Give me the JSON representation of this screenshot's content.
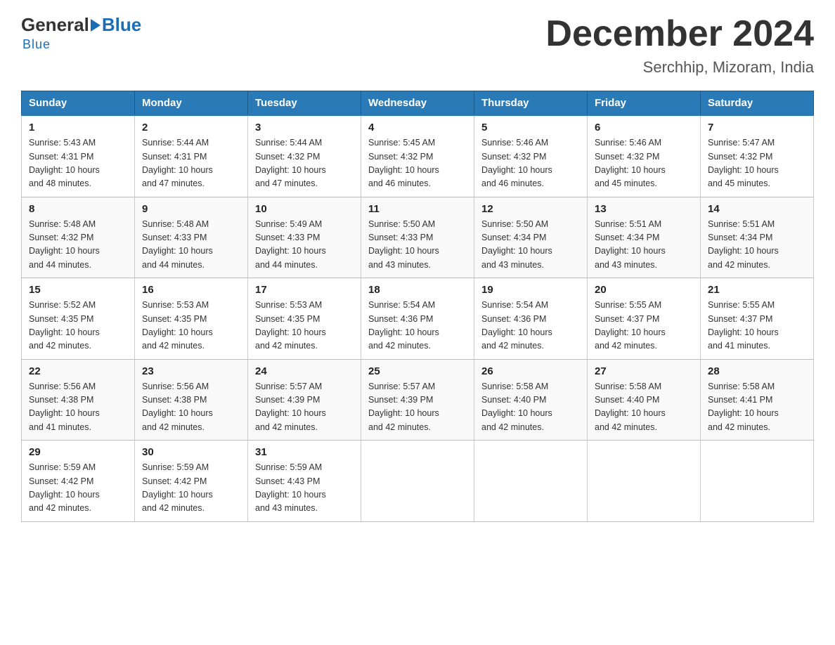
{
  "logo": {
    "general": "General",
    "blue": "Blue",
    "underline": "Blue"
  },
  "header": {
    "title": "December 2024",
    "subtitle": "Serchhip, Mizoram, India"
  },
  "weekdays": [
    "Sunday",
    "Monday",
    "Tuesday",
    "Wednesday",
    "Thursday",
    "Friday",
    "Saturday"
  ],
  "weeks": [
    [
      {
        "day": "1",
        "sunrise": "5:43 AM",
        "sunset": "4:31 PM",
        "daylight": "10 hours and 48 minutes."
      },
      {
        "day": "2",
        "sunrise": "5:44 AM",
        "sunset": "4:31 PM",
        "daylight": "10 hours and 47 minutes."
      },
      {
        "day": "3",
        "sunrise": "5:44 AM",
        "sunset": "4:32 PM",
        "daylight": "10 hours and 47 minutes."
      },
      {
        "day": "4",
        "sunrise": "5:45 AM",
        "sunset": "4:32 PM",
        "daylight": "10 hours and 46 minutes."
      },
      {
        "day": "5",
        "sunrise": "5:46 AM",
        "sunset": "4:32 PM",
        "daylight": "10 hours and 46 minutes."
      },
      {
        "day": "6",
        "sunrise": "5:46 AM",
        "sunset": "4:32 PM",
        "daylight": "10 hours and 45 minutes."
      },
      {
        "day": "7",
        "sunrise": "5:47 AM",
        "sunset": "4:32 PM",
        "daylight": "10 hours and 45 minutes."
      }
    ],
    [
      {
        "day": "8",
        "sunrise": "5:48 AM",
        "sunset": "4:32 PM",
        "daylight": "10 hours and 44 minutes."
      },
      {
        "day": "9",
        "sunrise": "5:48 AM",
        "sunset": "4:33 PM",
        "daylight": "10 hours and 44 minutes."
      },
      {
        "day": "10",
        "sunrise": "5:49 AM",
        "sunset": "4:33 PM",
        "daylight": "10 hours and 44 minutes."
      },
      {
        "day": "11",
        "sunrise": "5:50 AM",
        "sunset": "4:33 PM",
        "daylight": "10 hours and 43 minutes."
      },
      {
        "day": "12",
        "sunrise": "5:50 AM",
        "sunset": "4:34 PM",
        "daylight": "10 hours and 43 minutes."
      },
      {
        "day": "13",
        "sunrise": "5:51 AM",
        "sunset": "4:34 PM",
        "daylight": "10 hours and 43 minutes."
      },
      {
        "day": "14",
        "sunrise": "5:51 AM",
        "sunset": "4:34 PM",
        "daylight": "10 hours and 42 minutes."
      }
    ],
    [
      {
        "day": "15",
        "sunrise": "5:52 AM",
        "sunset": "4:35 PM",
        "daylight": "10 hours and 42 minutes."
      },
      {
        "day": "16",
        "sunrise": "5:53 AM",
        "sunset": "4:35 PM",
        "daylight": "10 hours and 42 minutes."
      },
      {
        "day": "17",
        "sunrise": "5:53 AM",
        "sunset": "4:35 PM",
        "daylight": "10 hours and 42 minutes."
      },
      {
        "day": "18",
        "sunrise": "5:54 AM",
        "sunset": "4:36 PM",
        "daylight": "10 hours and 42 minutes."
      },
      {
        "day": "19",
        "sunrise": "5:54 AM",
        "sunset": "4:36 PM",
        "daylight": "10 hours and 42 minutes."
      },
      {
        "day": "20",
        "sunrise": "5:55 AM",
        "sunset": "4:37 PM",
        "daylight": "10 hours and 42 minutes."
      },
      {
        "day": "21",
        "sunrise": "5:55 AM",
        "sunset": "4:37 PM",
        "daylight": "10 hours and 41 minutes."
      }
    ],
    [
      {
        "day": "22",
        "sunrise": "5:56 AM",
        "sunset": "4:38 PM",
        "daylight": "10 hours and 41 minutes."
      },
      {
        "day": "23",
        "sunrise": "5:56 AM",
        "sunset": "4:38 PM",
        "daylight": "10 hours and 42 minutes."
      },
      {
        "day": "24",
        "sunrise": "5:57 AM",
        "sunset": "4:39 PM",
        "daylight": "10 hours and 42 minutes."
      },
      {
        "day": "25",
        "sunrise": "5:57 AM",
        "sunset": "4:39 PM",
        "daylight": "10 hours and 42 minutes."
      },
      {
        "day": "26",
        "sunrise": "5:58 AM",
        "sunset": "4:40 PM",
        "daylight": "10 hours and 42 minutes."
      },
      {
        "day": "27",
        "sunrise": "5:58 AM",
        "sunset": "4:40 PM",
        "daylight": "10 hours and 42 minutes."
      },
      {
        "day": "28",
        "sunrise": "5:58 AM",
        "sunset": "4:41 PM",
        "daylight": "10 hours and 42 minutes."
      }
    ],
    [
      {
        "day": "29",
        "sunrise": "5:59 AM",
        "sunset": "4:42 PM",
        "daylight": "10 hours and 42 minutes."
      },
      {
        "day": "30",
        "sunrise": "5:59 AM",
        "sunset": "4:42 PM",
        "daylight": "10 hours and 42 minutes."
      },
      {
        "day": "31",
        "sunrise": "5:59 AM",
        "sunset": "4:43 PM",
        "daylight": "10 hours and 43 minutes."
      },
      null,
      null,
      null,
      null
    ]
  ]
}
